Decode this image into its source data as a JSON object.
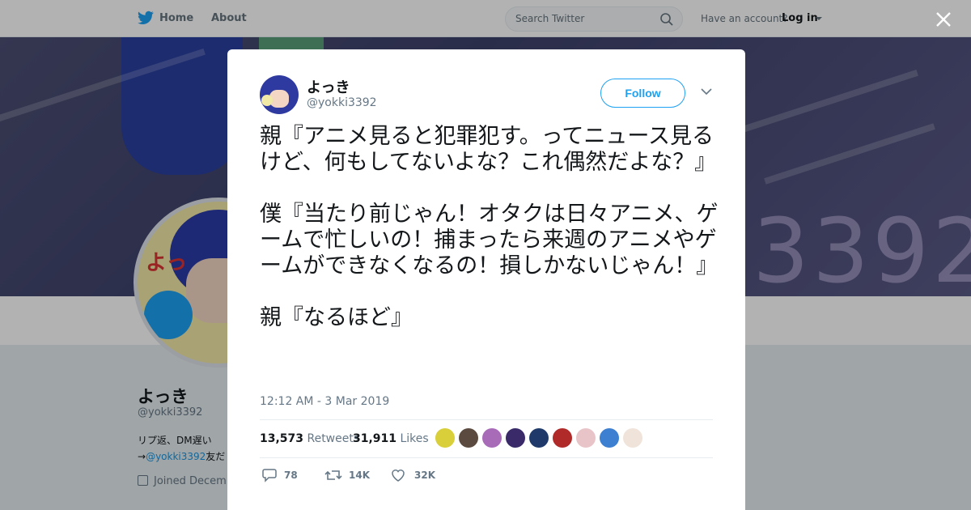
{
  "nav": {
    "home_label": "Home",
    "about_label": "About",
    "search_placeholder": "Search Twitter",
    "account_prompt": "Have an account?",
    "login_label": "Log in"
  },
  "profile": {
    "name": "よっき",
    "handle": "@yokki3392",
    "bio_line1": "リプ返、DM遅い",
    "bio_line2_prefix": "→",
    "bio_link": "@yokki3392",
    "bio_line2_suffix": "友だ",
    "joined": "Joined Decem",
    "banner_text": "3392"
  },
  "tweet": {
    "author_name": "よっき",
    "author_handle": "@yokki3392",
    "follow_label": "Follow",
    "text": "親『アニメ見ると犯罪犯す。ってニュース見るけど、何もしてないよな？これ偶然だよな？』\n\n僕『当たり前じゃん！オタクは日々アニメ、ゲームで忙しいの！捕まったら来週のアニメやゲームができなくなるの！損しかないじゃん！』\n\n親『なるほど』",
    "timestamp": "12:12 AM - 3 Mar 2019",
    "retweets_count": "13,573",
    "retweets_label": "Retweets",
    "likes_count": "31,911",
    "likes_label": "Likes",
    "reply_count": "78",
    "retweet_action_count": "14K",
    "like_action_count": "32K"
  },
  "colors": {
    "accent": "#1da1f2",
    "text": "#14171a",
    "muted": "#657786"
  }
}
